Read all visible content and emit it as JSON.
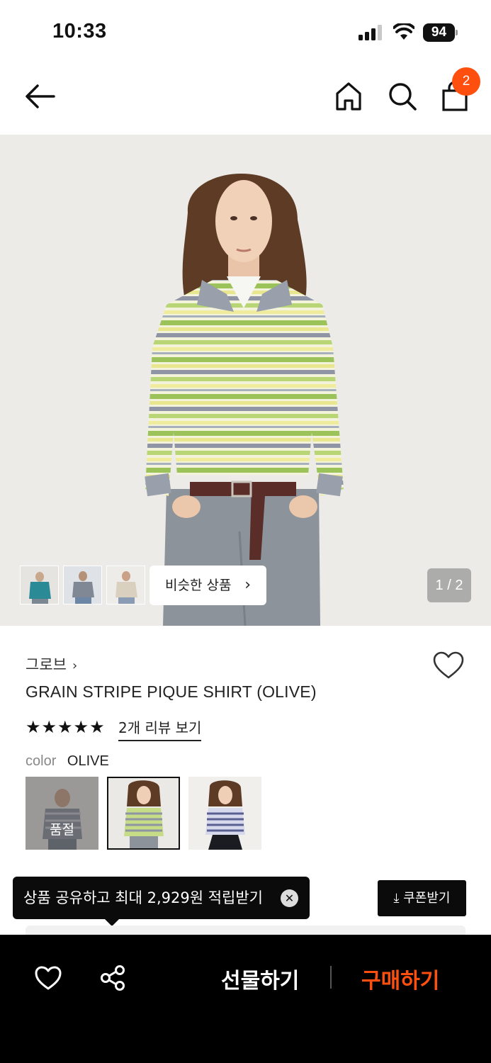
{
  "status_bar": {
    "time": "10:33",
    "battery": "94"
  },
  "header": {
    "cart_count": "2"
  },
  "gallery": {
    "similar_label": "비슷한 상품",
    "page_indicator": "1 / 2",
    "thumbnails": [
      "teal-sweater",
      "grey-sweater",
      "beige-sweater"
    ]
  },
  "product": {
    "brand": "그로브",
    "name": "GRAIN STRIPE PIQUE SHIRT (OLIVE)",
    "rating": 5,
    "reviews_link": "2개 리뷰 보기",
    "color_label": "color",
    "color_value": "OLIVE",
    "color_options": [
      {
        "name": "GREY",
        "sold_out": true,
        "sold_out_label": "품절"
      },
      {
        "name": "OLIVE",
        "selected": true
      },
      {
        "name": "NAVY"
      }
    ]
  },
  "promo": {
    "tooltip": "상품 공유하고 최대 2,929원 적립받기",
    "coupon_button": "쿠폰받기"
  },
  "bottom_bar": {
    "gift_label": "선물하기",
    "buy_label": "구매하기"
  },
  "colors": {
    "accent": "#ff4f0f",
    "dark": "#0b0b0b",
    "hero_bg": "#ecebe8"
  }
}
